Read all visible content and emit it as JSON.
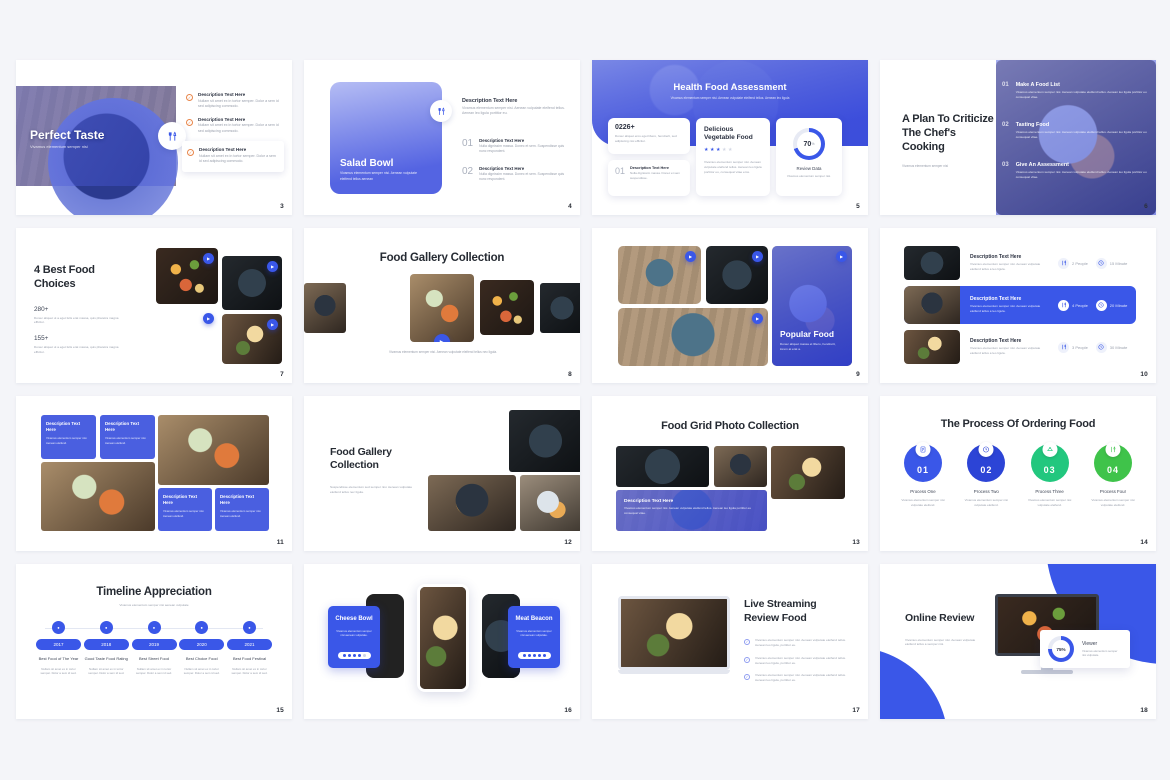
{
  "page": {
    "background": "#f4f5f9",
    "accent_blue": "#3a57e8",
    "accent_green": "#22c77e",
    "accent_green2": "#3fc34a",
    "accent_orange": "#e8864a"
  },
  "lorem": {
    "short": "Vivamus elementum semper nisi. Aenean vulputate eleifend tellus. Aenean leo ligula, porttitor eu.",
    "tiny": "Nullam sit amet ex in tortor semper. Dolor a sem id sed adipiscing commodo.",
    "mid": "Vivamus elementum semper nisi. Aenean vulputate eleifend tellus, aenean leo ligula porttitor eu.",
    "xs": "Vivamus elementum semper nisi, Aenean vulputate eleifend tellus.",
    "nano": "Nullam sit amet ex in tortor semper. Dolor a sem id."
  },
  "slides": [
    {
      "number": "3",
      "title": "Perfect Taste",
      "subtitle": "Vivamus elementum semper nisi",
      "icon": "cutlery-icon",
      "items": [
        {
          "heading": "Description Text Here",
          "body": "Nullam sit amet ex in tortor semper. Dolor a sem id sed adipiscing commodo."
        },
        {
          "heading": "Description Text Here",
          "body": "Nullam sit amet ex in tortor semper. Dolor a sem id sed adipiscing commodo."
        },
        {
          "heading": "Description Text Here",
          "body": "Nullam sit amet ex in tortor semper. Dolor a sem id sed adipiscing commodo."
        }
      ]
    },
    {
      "number": "4",
      "title": "Salad Bowl",
      "subtitle": "Vivamus elementum semper nisi. Aenean vulputate eleifend tellus aenean",
      "icon": "cutlery-icon",
      "lead_heading": "Description Text Here",
      "lead_body": "Vivamus elementum semper nisi. Aenean vulputate eleifend tellus. Aenean leo ligula porttitor eu.",
      "items": [
        {
          "num": "01",
          "heading": "Description Text Here",
          "body": "Nulla dignissim massa. Donec et sem. Suspendisse quis nunc respondent."
        },
        {
          "num": "02",
          "heading": "Description Text Here",
          "body": "Nulla dignissim massa. Donec et sem. Suspendisse quis nunc respondent."
        }
      ]
    },
    {
      "number": "5",
      "title": "Health Food Assessment",
      "subtitle": "Vivamus elementum semper nisi. Aenean vulputate eleifend tellus. Aenean leo ligula",
      "stat_value": "0226+",
      "stat_body": "Donec aliquet eros eget libero, hendrerit, sed adipiscing nisi efficitur.",
      "item_num": "01",
      "item_heading": "Description Text Here",
      "item_body": "Nulla dignissim massa. Donec et sem suspendisse.",
      "center_title": "Delicious Vegetable Food",
      "center_body": "Vivamus elementum semper nisi. Aenean vulputate eleifend tellus. Aenean leo ligula porttitor eu, consequat vitae eros.",
      "stars_filled": 3,
      "stars_total": 5,
      "donut_value": "70",
      "donut_unit": "%",
      "donut_percent": 70,
      "donut_label": "Review Data",
      "donut_body": "Vivamus elementum semper nisi."
    },
    {
      "number": "6",
      "title": "A Plan To Criticize The Chef's Cooking",
      "subtitle": "Vivamus elementum semper nisi",
      "steps": [
        {
          "num": "01",
          "heading": "Make A Food List",
          "body": "Vivamus elementum semper nisi. Aenean vulputate eleifend tellus. Aenean leo ligula porttitor eu consequat vitae."
        },
        {
          "num": "02",
          "heading": "Tasting Food",
          "body": "Vivamus elementum semper nisi. Aenean vulputate eleifend tellus. Aenean leo ligula porttitor eu consequat vitae."
        },
        {
          "num": "03",
          "heading": "Give An Assessment",
          "body": "Vivamus elementum semper nisi. Aenean vulputate eleifend tellus. Aenean leo ligula porttitor eu consequat vitae."
        }
      ]
    },
    {
      "number": "7",
      "title": "4 Best Food Choices",
      "stats": [
        {
          "value": "280+",
          "body": "Donec aliquet ut a eget felis erat massa, quis pharetra magna efficitur."
        },
        {
          "value": "155+",
          "body": "Donec aliquet ut a eget felis erat massa, quis pharetra magna efficitur."
        }
      ]
    },
    {
      "number": "8",
      "title": "Food Gallery Collection",
      "caption": "Vivamus elementum semper nisi. Aenean vulputate eleifend tellus nec ligula."
    },
    {
      "number": "9",
      "overlay_title": "Popular Food",
      "overlay_body": "Donec aliquet massa et libero, hendrerit, lorem at erat a."
    },
    {
      "number": "10",
      "rows": [
        {
          "heading": "Description Text Here",
          "body": "Vivamus elementum semper nisi. Aenean vulputate eleifend tellus a leo ligula.",
          "meta1": "2 People",
          "meta2": "15 Minute",
          "active": false
        },
        {
          "heading": "Description Text Here",
          "body": "Vivamus elementum semper nisi. Aenean vulputate eleifend tellus a leo ligula.",
          "meta1": "4 People",
          "meta2": "20 Minute",
          "active": true
        },
        {
          "heading": "Description Text Here",
          "body": "Vivamus elementum semper nisi. Aenean vulputate eleifend tellus a leo ligula.",
          "meta1": "3 People",
          "meta2": "30 Minute",
          "active": false
        }
      ]
    },
    {
      "number": "11",
      "cards": [
        {
          "heading": "Description Text Here",
          "body": "Vivamus elementum semper nisi. Aenean eleifend."
        },
        {
          "heading": "Description Text Here",
          "body": "Vivamus elementum semper nisi. Aenean eleifend."
        },
        {
          "heading": "Description Text Here",
          "body": "Vivamus elementum semper nisi. Aenean eleifend."
        },
        {
          "heading": "Description Text Here",
          "body": "Vivamus elementum semper nisi. Aenean eleifend."
        }
      ]
    },
    {
      "number": "12",
      "title": "Food Gallery Collection",
      "body": "Suspendisse elementum sed semper nisi. Aenean vulputate eleifend tellus nec ligula."
    },
    {
      "number": "13",
      "title": "Food Grid Photo Collection",
      "overlay_heading": "Description Text Here",
      "overlay_body": "Vivamus elementum semper nisi. Aenean vulputate eleifend tellus. Aenean leo ligula porttitor eu consequat vitae."
    },
    {
      "number": "14",
      "title": "The Process Of Ordering Food",
      "steps": [
        {
          "num": "01",
          "label": "Process One",
          "body": "Vivamus elementum semper nisi vulputate eleifend.",
          "color": "#3a57e8",
          "icon": "list-icon"
        },
        {
          "num": "02",
          "label": "Process Two",
          "body": "Vivamus elementum semper nisi vulputate eleifend.",
          "color": "#2c44d6",
          "icon": "clock-icon"
        },
        {
          "num": "03",
          "label": "Process Three",
          "body": "Vivamus elementum semper nisi vulputate eleifend.",
          "color": "#22c77e",
          "icon": "delivery-icon"
        },
        {
          "num": "04",
          "label": "Process Four",
          "body": "Vivamus elementum semper nisi vulputate eleifend.",
          "color": "#3fc34a",
          "icon": "cutlery-icon"
        }
      ]
    },
    {
      "number": "15",
      "title": "Timeline Appreciation",
      "subtitle": "Vivamus elementum semper nisi aenean vulputate",
      "points": [
        {
          "year": "2017",
          "label": "Best Food of The Year",
          "body": "Nullam sit amet ex in tortor semper. Dolor a sem id sed."
        },
        {
          "year": "2018",
          "label": "Good Taste Food Rating",
          "body": "Nullam sit amet ex in tortor semper. Dolor a sem id sed."
        },
        {
          "year": "2019",
          "label": "Best Street Food",
          "body": "Nullam sit amet ex in tortor semper. Dolor a sem id sed."
        },
        {
          "year": "2020",
          "label": "Best Choice Food",
          "body": "Nullam sit amet ex in tortor semper. Dolor a sem id sed."
        },
        {
          "year": "2021",
          "label": "Best Food Festival",
          "body": "Nullam sit amet ex in tortor semper. Dolor a sem id sed."
        }
      ]
    },
    {
      "number": "16",
      "left_card": {
        "title": "Cheese Bowl",
        "body": "Vivamus elementum semper nisi aenean vulputate.",
        "stars": 4
      },
      "right_card": {
        "title": "Meat Beacon",
        "body": "Vivamus elementum semper nisi aenean vulputate.",
        "stars": 5
      }
    },
    {
      "number": "17",
      "title": "Live Streaming Review Food",
      "bullets": [
        "Vivamus elementum semper nisi. Aenean vulputate eleifend tellus. Aenean leo ligula, porttitor eu.",
        "Vivamus elementum semper nisi. Aenean vulputate eleifend tellus. Aenean leo ligula, porttitor eu.",
        "Vivamus elementum semper nisi. Aenean vulputate eleifend tellus. Aenean leo ligula, porttitor eu."
      ]
    },
    {
      "number": "18",
      "title": "Online Review",
      "body": "Vivamus elementum semper nisi. Aenean vulputate eleifend tellus a semper nisi.",
      "donut_value": "75%",
      "donut_percent": 75,
      "card_title": "Viewer",
      "card_body": "Vivamus elementum semper nisi vulputate."
    }
  ]
}
